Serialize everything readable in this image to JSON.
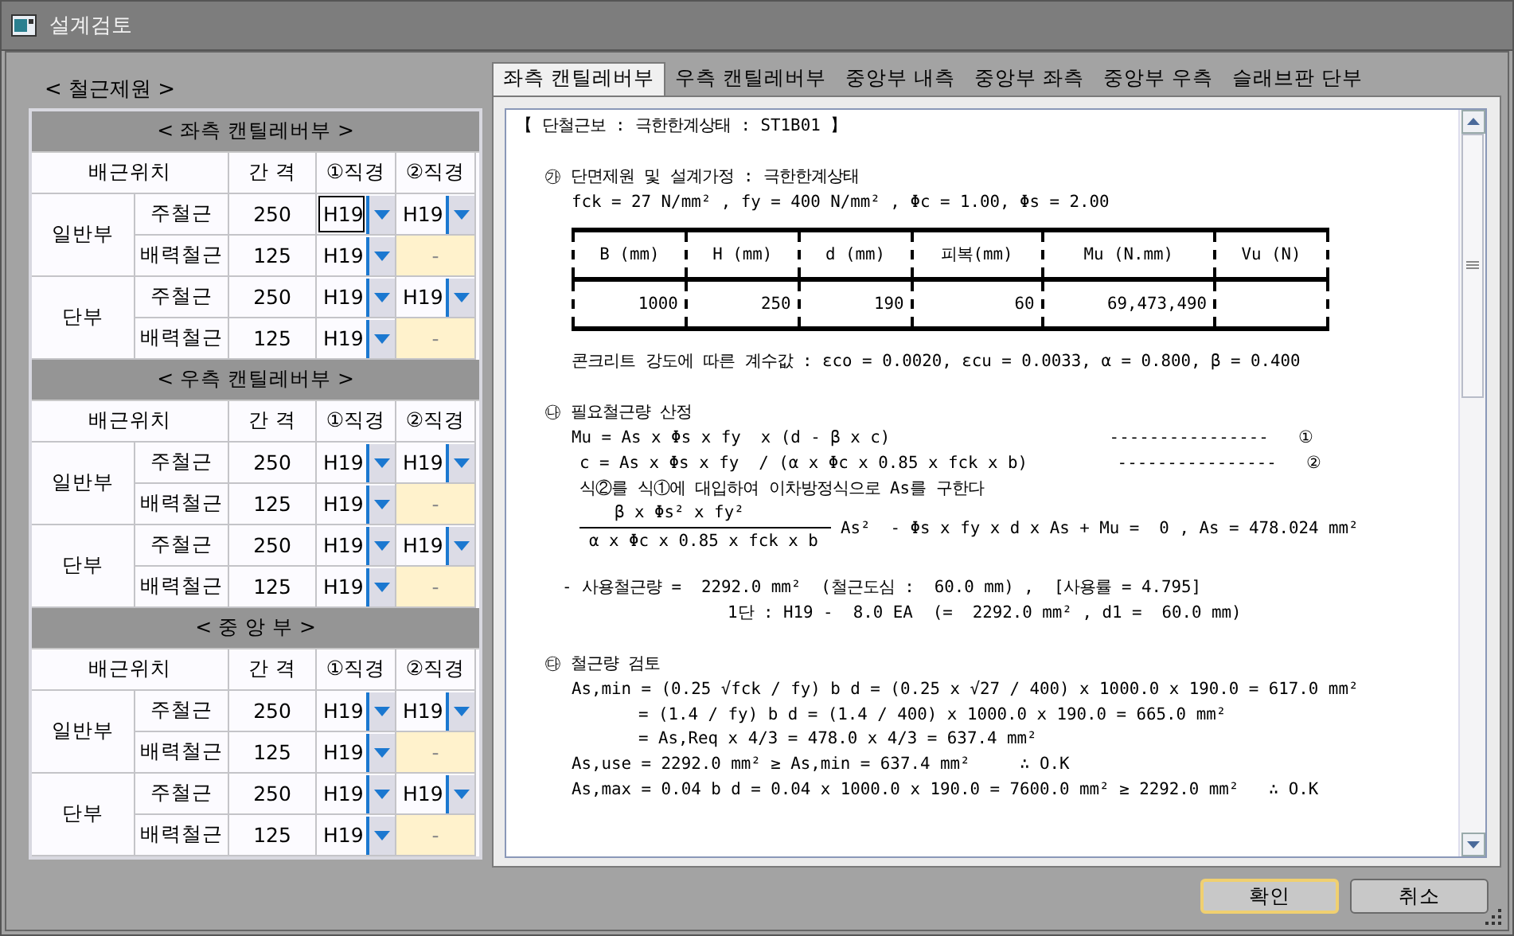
{
  "window": {
    "title": "설계검토"
  },
  "left_panel": {
    "label": "< 철근제원 >",
    "sections": [
      {
        "title": "< 좌측 캔틸레버부 >",
        "columns": [
          "배근위치",
          "간 격",
          "①직경",
          "②직경"
        ],
        "groups": [
          {
            "name": "일반부",
            "rows": [
              {
                "label": "주철근",
                "spacing": "250",
                "dia1": {
                  "value": "H19",
                  "focused": true
                },
                "dia2": {
                  "value": "H19",
                  "editable": true
                }
              },
              {
                "label": "배력철근",
                "spacing": "125",
                "dia1": {
                  "value": "H19",
                  "focused": false
                },
                "dia2": {
                  "value": "-",
                  "editable": false
                }
              }
            ]
          },
          {
            "name": "단부",
            "rows": [
              {
                "label": "주철근",
                "spacing": "250",
                "dia1": {
                  "value": "H19",
                  "focused": false
                },
                "dia2": {
                  "value": "H19",
                  "editable": true
                }
              },
              {
                "label": "배력철근",
                "spacing": "125",
                "dia1": {
                  "value": "H19",
                  "focused": false
                },
                "dia2": {
                  "value": "-",
                  "editable": false
                }
              }
            ]
          }
        ]
      },
      {
        "title": "< 우측 캔틸레버부 >",
        "columns": [
          "배근위치",
          "간 격",
          "①직경",
          "②직경"
        ],
        "groups": [
          {
            "name": "일반부",
            "rows": [
              {
                "label": "주철근",
                "spacing": "250",
                "dia1": {
                  "value": "H19",
                  "focused": false
                },
                "dia2": {
                  "value": "H19",
                  "editable": true
                }
              },
              {
                "label": "배력철근",
                "spacing": "125",
                "dia1": {
                  "value": "H19",
                  "focused": false
                },
                "dia2": {
                  "value": "-",
                  "editable": false
                }
              }
            ]
          },
          {
            "name": "단부",
            "rows": [
              {
                "label": "주철근",
                "spacing": "250",
                "dia1": {
                  "value": "H19",
                  "focused": false
                },
                "dia2": {
                  "value": "H19",
                  "editable": true
                }
              },
              {
                "label": "배력철근",
                "spacing": "125",
                "dia1": {
                  "value": "H19",
                  "focused": false
                },
                "dia2": {
                  "value": "-",
                  "editable": false
                }
              }
            ]
          }
        ]
      },
      {
        "title": "< 중 앙 부 >",
        "columns": [
          "배근위치",
          "간 격",
          "①직경",
          "②직경"
        ],
        "groups": [
          {
            "name": "일반부",
            "rows": [
              {
                "label": "주철근",
                "spacing": "250",
                "dia1": {
                  "value": "H19",
                  "focused": false
                },
                "dia2": {
                  "value": "H19",
                  "editable": true
                }
              },
              {
                "label": "배력철근",
                "spacing": "125",
                "dia1": {
                  "value": "H19",
                  "focused": false
                },
                "dia2": {
                  "value": "-",
                  "editable": false
                }
              }
            ]
          },
          {
            "name": "단부",
            "rows": [
              {
                "label": "주철근",
                "spacing": "250",
                "dia1": {
                  "value": "H19",
                  "focused": false
                },
                "dia2": {
                  "value": "H19",
                  "editable": true
                }
              },
              {
                "label": "배력철근",
                "spacing": "125",
                "dia1": {
                  "value": "H19",
                  "focused": false
                },
                "dia2": {
                  "value": "-",
                  "editable": false
                }
              }
            ]
          }
        ]
      }
    ]
  },
  "tabs": [
    {
      "label": "좌측 캔틸레버부",
      "selected": true
    },
    {
      "label": "우측 캔틸레버부",
      "selected": false
    },
    {
      "label": "중앙부 내측",
      "selected": false
    },
    {
      "label": "중앙부 좌측",
      "selected": false
    },
    {
      "label": "중앙부 우측",
      "selected": false
    },
    {
      "label": "슬래브판 단부",
      "selected": false
    }
  ],
  "report": [
    {
      "kind": "title",
      "text": "【 단철근보 : 극한한계상태 : ST1B01 】"
    },
    {
      "kind": "heading",
      "text": "㉮ 단면제원 및 설계가정 : 극한한계상태"
    },
    {
      "kind": "body",
      "text": "fck = 27 N/mm² , fy = 400 N/mm² , Φc = 1.00, Φs = 2.00"
    },
    {
      "kind": "table",
      "columns": [
        "B (mm)",
        "H (mm)",
        "d (mm)",
        "피복(mm)",
        "Mu (N.mm)",
        "Vu (N)"
      ],
      "cells": [
        "1000",
        "250",
        "190",
        "60",
        "69,473,490"
      ]
    },
    {
      "kind": "body",
      "text": "콘크리트 강도에 따른 계수값 : εco = 0.0020, εcu = 0.0033, α = 0.800, β = 0.400"
    },
    {
      "kind": "heading",
      "text": "㉯ 필요철근량 산정"
    },
    {
      "kind": "body",
      "text": "Mu = As x Φs x fy  x (d - β x c)                      ----------------   ①"
    },
    {
      "kind": "inset",
      "text": "c = As x Φs x fy  / (α x Φc x 0.85 x fck x b)         ----------------   ②"
    },
    {
      "kind": "inset",
      "text": "식②를 식①에 대입하여 이차방정식으로 As를 구한다"
    },
    {
      "kind": "fraction",
      "numerator": "β x Φs² x fy²",
      "denominator": "α x Φc x 0.85 x fck x b",
      "text": "As²  - Φs x fy x d x As + Mu =  0 , As = 478.024 mm²"
    },
    {
      "kind": "note",
      "text": "- 사용철근량 =  2292.0 mm²  (철근도심 :  60.0 mm) ,  [사용률 = 4.795]"
    },
    {
      "kind": "note-cont",
      "text": "1단 : H19 -  8.0 EA  (=  2292.0 mm² , d1 =  60.0 mm)"
    },
    {
      "kind": "heading",
      "text": "㉰ 철근량 검토"
    },
    {
      "kind": "body",
      "text": "As,min = (0.25 √fck / fy) b d = (0.25 x √27 / 400) x 1000.0 x 190.0 = 617.0 mm²"
    },
    {
      "kind": "cont",
      "text": "= (1.4 / fy) b d = (1.4 / 400) x 1000.0 x 190.0 = 665.0 mm²"
    },
    {
      "kind": "cont",
      "text": "= As,Req x 4/3 = 478.0 x 4/3 = 637.4 mm²"
    },
    {
      "kind": "body",
      "text": "As,use = 2292.0 mm² ≥ As,min = 637.4 mm²     ∴ O.K"
    },
    {
      "kind": "body",
      "text": "As,max = 0.04 b d = 0.04 x 1000.0 x 190.0 = 7600.0 mm² ≥ 2292.0 mm²   ∴ O.K"
    }
  ],
  "buttons": [
    {
      "label": "확인",
      "default": true
    },
    {
      "label": "취소",
      "default": false
    }
  ]
}
